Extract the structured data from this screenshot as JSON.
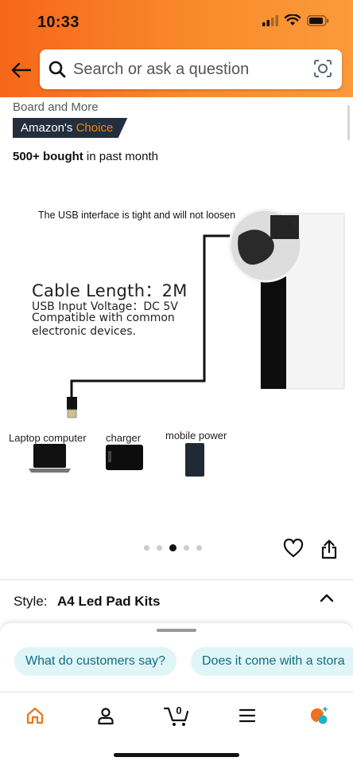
{
  "status_bar": {
    "time": "10:33"
  },
  "search": {
    "placeholder": "Search or ask a question"
  },
  "product": {
    "title_fragment": "Board and More",
    "badge_prefix": "Amazon's",
    "badge_highlight": "Choice",
    "bought_count": "500+ bought",
    "bought_suffix": " in past month"
  },
  "image": {
    "usb_note": "The USB interface is tight and will not loosen",
    "cable_length": "Cable Length：2M",
    "spec_lines": [
      "USB Input Voltage：DC 5V",
      "Compatible with common",
      "electronic devices."
    ],
    "devices": [
      "Laptop computer",
      "charger",
      "mobile power"
    ]
  },
  "carousel": {
    "count": 5,
    "active_index": 2
  },
  "style_row": {
    "label": "Style:",
    "value": "A4 Led Pad Kits"
  },
  "rufus": {
    "chips": [
      "What do customers say?",
      "Does it come with a stora"
    ]
  },
  "nav": {
    "cart_count": "0"
  },
  "colors": {
    "header_start": "#f7661a",
    "header_end": "#fb9a3a",
    "badge_bg": "#232f3e",
    "badge_highlight": "#f08804",
    "chip_bg": "#dff5f7",
    "chip_text": "#0f6d85",
    "home_active": "#e8751a"
  },
  "icons": [
    "back-arrow-icon",
    "search-icon",
    "camera-lens-icon",
    "heart-icon",
    "share-icon",
    "chevron-up-icon",
    "home-icon",
    "account-icon",
    "cart-icon",
    "menu-icon",
    "rufus-icon"
  ]
}
